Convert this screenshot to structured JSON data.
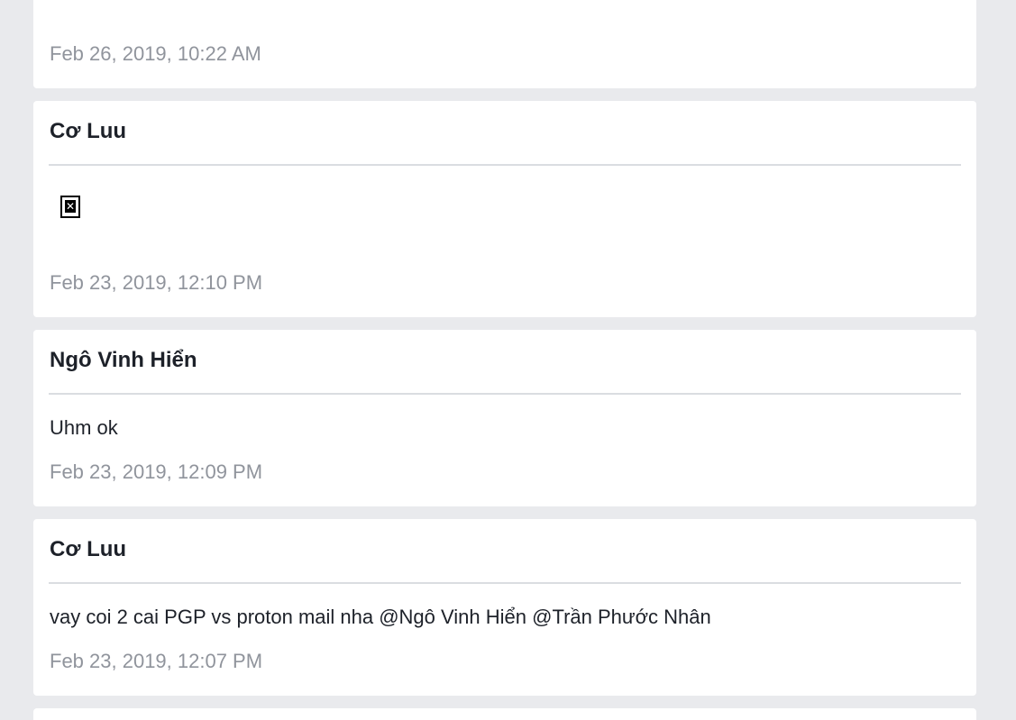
{
  "messages": [
    {
      "sender": "",
      "body": "",
      "timestamp": "Feb 26, 2019, 10:22 AM"
    },
    {
      "sender": "Cơ Luu",
      "body": "",
      "attachment": "broken-image",
      "timestamp": "Feb 23, 2019, 12:10 PM"
    },
    {
      "sender": "Ngô Vinh Hiển",
      "body": "Uhm ok",
      "timestamp": "Feb 23, 2019, 12:09 PM"
    },
    {
      "sender": "Cơ Luu",
      "body": "vay coi 2 cai PGP vs proton mail nha @Ngô Vinh Hiển @Trần Phước Nhân",
      "timestamp": "Feb 23, 2019, 12:07 PM"
    }
  ],
  "colors": {
    "page_background": "#e9eaed",
    "card_background": "#ffffff",
    "sender_text": "#1d2129",
    "timestamp_text": "#90949c",
    "divider": "#dadde1"
  },
  "icons": {
    "attachment": "broken-image-icon"
  }
}
